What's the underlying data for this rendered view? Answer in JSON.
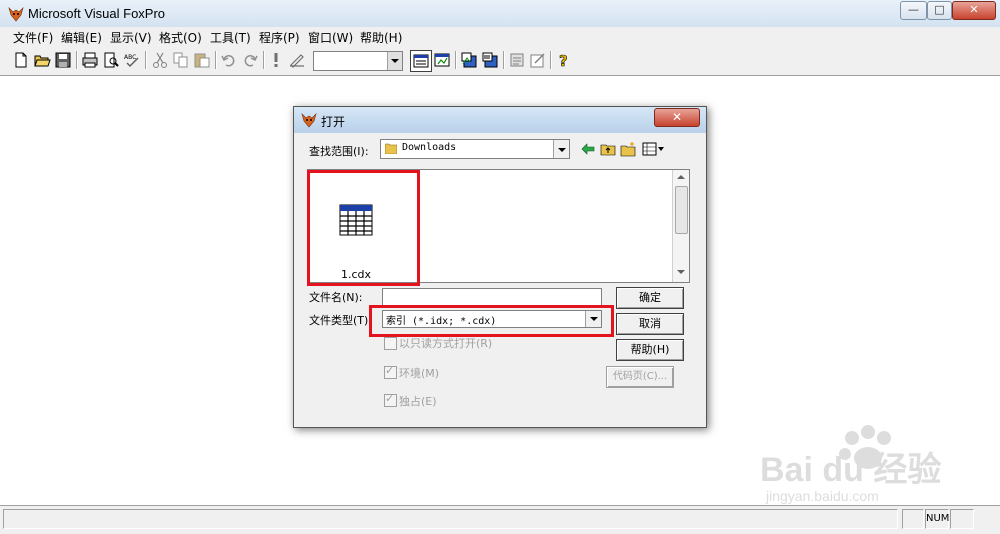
{
  "app": {
    "title": "Microsoft Visual FoxPro",
    "window_buttons": {
      "minimize": "—",
      "maximize": "□",
      "close": "✕"
    }
  },
  "menu": [
    "文件(F)",
    "编辑(E)",
    "显示(V)",
    "格式(O)",
    "工具(T)",
    "程序(P)",
    "窗口(W)",
    "帮助(H)"
  ],
  "toolbar": {
    "icons": [
      "new-icon",
      "open-icon",
      "save-icon",
      "print-icon",
      "print-preview-icon",
      "spell-check-icon",
      "cut-icon",
      "copy-icon",
      "paste-icon",
      "undo-icon",
      "redo-icon",
      "run-icon",
      "modify-form-icon",
      "command-window-icon",
      "data-session-icon",
      "form-designer-icon",
      "report-designer-icon",
      "code-icon",
      "properties-icon",
      "help-icon"
    ],
    "combo_value": ""
  },
  "dialog": {
    "title": "打开",
    "close": "✕",
    "look_in_label": "查找范围(I):",
    "look_in_value": "Downloads",
    "files": [
      {
        "name": "1.cdx",
        "icon": "table-file-icon"
      }
    ],
    "filename_label": "文件名(N):",
    "filename_value": "",
    "filetype_label": "文件类型(T)",
    "filetype_value": "索引 (*.idx; *.cdx)",
    "readonly_label": "以只读方式打开(R)",
    "environment_label": "环境(M)",
    "exclusive_label": "独占(E)",
    "buttons": {
      "ok": "确定",
      "cancel": "取消",
      "help": "帮助(H)",
      "codepage": "代码页(C)..."
    }
  },
  "status": {
    "num": "NUM"
  },
  "watermark": {
    "brand": "Bai du 经验",
    "url": "jingyan.baidu.com"
  },
  "colors": {
    "highlight": "#e4141f",
    "title_bg": "#d3e2f1",
    "chrome": "#f0f0f0"
  }
}
